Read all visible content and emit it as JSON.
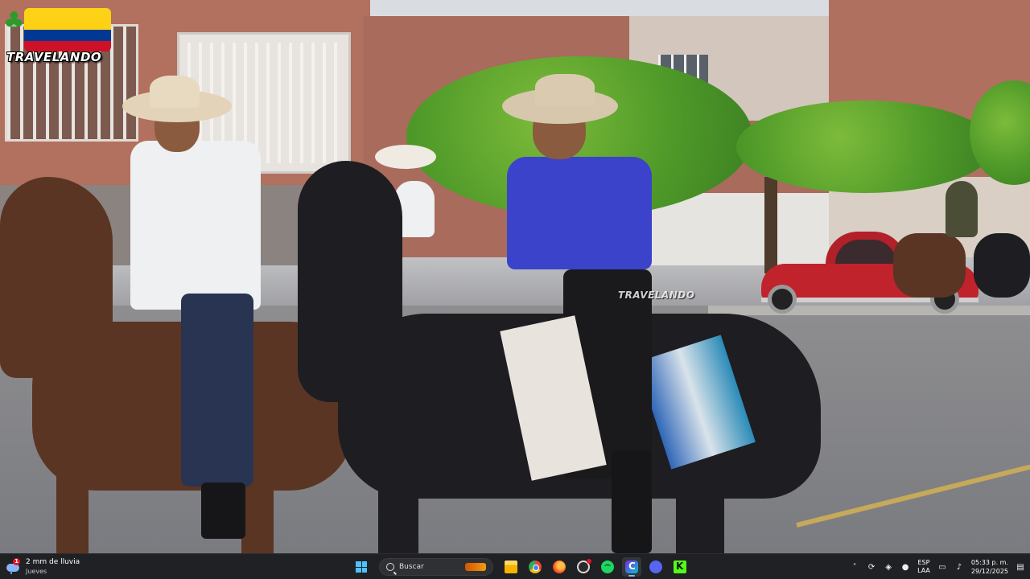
{
  "video": {
    "channel_logo_text": "TRAVELANDO",
    "watermark_text": "TRAVELANDO"
  },
  "taskbar": {
    "weather": {
      "alert_count": "1",
      "line1": "2 mm de lluvia",
      "line2": "Jueves",
      "icon": "rain-cloud-icon"
    },
    "start_icon": "windows-logo-icon",
    "search": {
      "label": "Buscar",
      "icon": "search-icon"
    },
    "pinned": [
      {
        "name": "file-explorer-icon"
      },
      {
        "name": "chrome-icon"
      },
      {
        "name": "firefox-icon"
      },
      {
        "name": "app-icon"
      },
      {
        "name": "spotify-icon"
      },
      {
        "name": "canva-icon"
      },
      {
        "name": "discord-icon"
      },
      {
        "name": "kick-icon"
      }
    ],
    "tray": {
      "chevron": "˄",
      "language_line1": "ESP",
      "language_line2": "LAA",
      "time": "05:33 p. m.",
      "date": "29/12/2025"
    }
  },
  "colors": {
    "taskbar_bg": "#202124",
    "accent": "#4cc2ff"
  }
}
